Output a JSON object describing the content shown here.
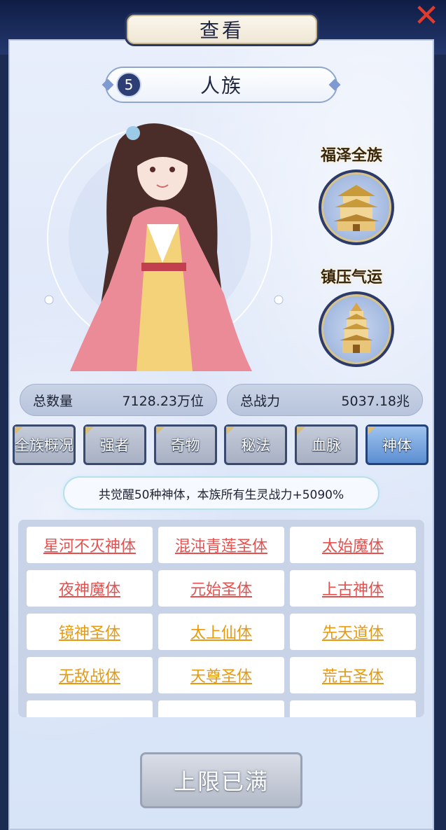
{
  "header": {
    "title": "查看"
  },
  "race": {
    "level": "5",
    "name": "人族"
  },
  "badges": [
    {
      "label": "福泽全族",
      "icon": "pavilion-icon"
    },
    {
      "label": "镇压气运",
      "icon": "pagoda-icon"
    }
  ],
  "stats": {
    "total_count_label": "总数量",
    "total_count_value": "7128.23万位",
    "total_power_label": "总战力",
    "total_power_value": "5037.18兆"
  },
  "tabs": [
    "全族概况",
    "强者",
    "奇物",
    "秘法",
    "血脉",
    "神体"
  ],
  "active_tab": "神体",
  "info": "共觉醒50种神体，本族所有生灵战力+5090%",
  "bodies": [
    [
      "星河不灭神体",
      "混沌青莲圣体",
      "太始魔体"
    ],
    [
      "夜神魔体",
      "元始圣体",
      "上古神体"
    ],
    [
      "镜神圣体",
      "太上仙体",
      "先天道体"
    ],
    [
      "无敌战体",
      "天尊圣体",
      "荒古圣体"
    ]
  ],
  "colors": {
    "red_body": "#e4514f",
    "orange_body": "#e59a12",
    "accent": "#2c3e73"
  },
  "action_button": "上限已满"
}
